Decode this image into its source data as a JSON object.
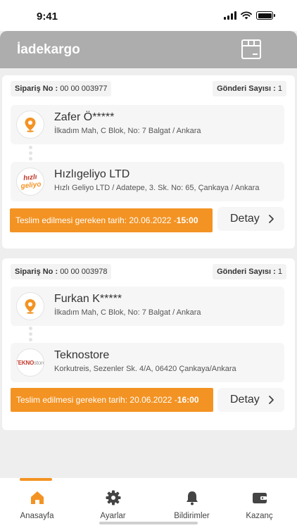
{
  "status_bar": {
    "time": "9:41"
  },
  "header": {
    "title": "İadekargo",
    "icon": "package-box-icon"
  },
  "orders": [
    {
      "order_no_label": "Sipariş No :",
      "order_no": "00 00 003977",
      "shipment_count_label": "Gönderi Sayısı :",
      "shipment_count": "1",
      "sender": {
        "name": "Zafer Ö*****",
        "address": "İlkadım Mah,  C Blok, No: 7 Balgat / Ankara",
        "icon": "location-pin-icon"
      },
      "receiver": {
        "name": "Hızlıgeliyo LTD",
        "address": "Hızlı Geliyo LTD / Adatepe, 3. Sk. No: 65, Çankaya / Ankara",
        "logo_text_top": "hızlı",
        "logo_text_bottom": "geliyo"
      },
      "deadline_label": "Teslim edilmesi gereken tarih: 20.06.2022 -",
      "deadline_time": "15:00",
      "detail_label": "Detay"
    },
    {
      "order_no_label": "Sipariş No :",
      "order_no": "00 00 003978",
      "shipment_count_label": "Gönderi Sayısı :",
      "shipment_count": "1",
      "sender": {
        "name": "Furkan K*****",
        "address": "İlkadım Mah,  C Blok, No: 7 Balgat / Ankara",
        "icon": "location-pin-icon"
      },
      "receiver": {
        "name": "Teknostore",
        "address": "Korkutreis, Sezenler Sk. 4/A, 06420 Çankaya/Ankara",
        "logo_text_a": "TEKNO",
        "logo_text_b": "store"
      },
      "deadline_label": "Teslim edilmesi gereken tarih:  20.06.2022 -",
      "deadline_time": "16:00",
      "detail_label": "Detay"
    }
  ],
  "tabs": [
    {
      "label": "Anasayfa",
      "icon": "home-icon",
      "active": true
    },
    {
      "label": "Ayarlar",
      "icon": "gear-icon",
      "active": false
    },
    {
      "label": "Bildirimler",
      "icon": "bell-icon",
      "active": false
    },
    {
      "label": "Kazanç",
      "icon": "wallet-icon",
      "active": false
    }
  ],
  "colors": {
    "accent": "#f39323",
    "header_bg": "#adadad",
    "page_bg": "#eeeeee"
  }
}
